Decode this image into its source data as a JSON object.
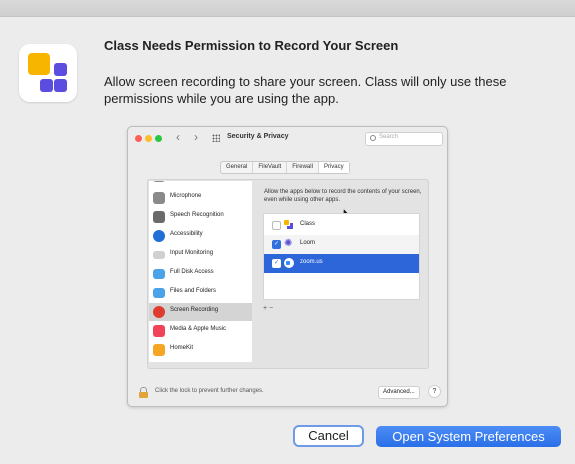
{
  "dialog": {
    "title": "Class Needs Permission to Record Your Screen",
    "description": "Allow screen recording to share your screen. Class will only use these permissions while you are using the app.",
    "cancel_label": "Cancel",
    "open_label": "Open System Preferences"
  },
  "prefs": {
    "window_title": "Security & Privacy",
    "search_placeholder": "Search",
    "tabs": [
      "General",
      "FileVault",
      "Firewall",
      "Privacy"
    ],
    "active_tab": "Privacy",
    "sidebar": [
      {
        "label": "Microphone",
        "icon": "microphone-icon",
        "color": "#8a8a8a"
      },
      {
        "label": "Speech Recognition",
        "icon": "speech-recognition-icon",
        "color": "#6b6b6b"
      },
      {
        "label": "Accessibility",
        "icon": "accessibility-icon",
        "color": "#1f6fd6"
      },
      {
        "label": "Input Monitoring",
        "icon": "keyboard-icon",
        "color": "#d0d0d0"
      },
      {
        "label": "Full Disk Access",
        "icon": "folder-icon",
        "color": "#4aa3e8"
      },
      {
        "label": "Files and Folders",
        "icon": "folder-icon",
        "color": "#4aa3e8"
      },
      {
        "label": "Screen Recording",
        "icon": "screen-recording-icon",
        "color": "#e03b2f",
        "selected": true
      },
      {
        "label": "Media & Apple Music",
        "icon": "music-icon",
        "color": "#f0435a"
      },
      {
        "label": "HomeKit",
        "icon": "home-icon",
        "color": "#f5a623"
      }
    ],
    "instructions": "Allow the apps below to record the contents of your screen, even while using other apps.",
    "apps": [
      {
        "label": "Class",
        "checked": false,
        "icon": "class-app-icon"
      },
      {
        "label": "Loom",
        "checked": true,
        "icon": "loom-icon"
      },
      {
        "label": "zoom.us",
        "checked": true,
        "icon": "zoom-icon",
        "selected": true
      }
    ],
    "add_remove": "+ −",
    "lock_text": "Click the lock to prevent further changes.",
    "advanced_label": "Advanced...",
    "help_label": "?"
  }
}
